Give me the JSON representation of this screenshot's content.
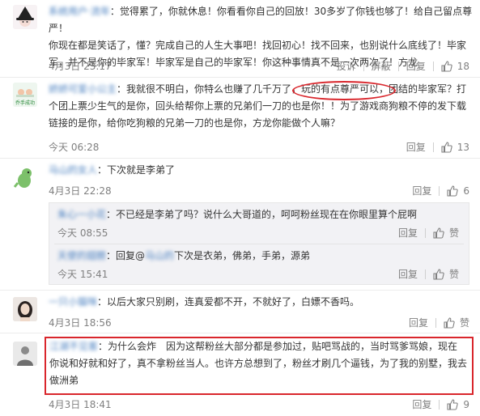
{
  "comments": [
    {
      "username": "系统用户·流年",
      "text_lines": [
        "觉得累了，你就休息！你看看你自己的回放！30多岁了你钱也够了！给自己留点尊严！",
        "你现在都是笑话了，懂？完成自己的人生大事吧！找回初心！找不回来，也别说什么底线了！毕家",
        "军，并不是你的毕家军！毕家军是自己的毕家军！你这种事情真不是一次两次了！方龙"
      ],
      "time": "4月3日 23:17",
      "actions": [
        "投诉",
        "屏蔽",
        "回复"
      ],
      "likes": "18"
    },
    {
      "username": "娇娇可爱小公主",
      "avatar_text": "乔手成功",
      "text_lines": [
        "我就很不明白，你特么也赚了几千万了，玩的有点尊严可以，团结的毕家军？打",
        "个团上票少生气的是你，回头给帮你上票的兄弟们一刀的也是你！！为了游戏商狗粮不停的发下载",
        "链接的是你，给你吃狗粮的兄弟一刀的也是你，方龙你能做个人嘛？"
      ],
      "time": "今天 06:28",
      "actions": [
        "回复"
      ],
      "likes": "13"
    },
    {
      "username": "马山的女人",
      "text": "下次就是李弟了",
      "time": "4月3日 22:28",
      "actions": [
        "回复"
      ],
      "likes": "6",
      "replies": [
        {
          "username": "朱心一小花",
          "text": "：不已经是李弟了吗？说什么大哥道的，呵呵粉丝现在在你眼里算个屁啊",
          "time": "今天 08:55",
          "actions": [
            "回复"
          ],
          "likes": "赞"
        },
        {
          "username": "天使的翅膀",
          "reply_label": "：回复@",
          "mention": "马山的",
          "text": "下次是衣弟，佛弟，手弟，源弟",
          "time": "今天 15:41",
          "actions": [
            "回复"
          ],
          "likes": "赞"
        }
      ]
    },
    {
      "username": "一只小猫咪",
      "text": "：以后大家只别刷，连真爱都不开，不就好了，白嫖不香吗。",
      "time": "4月3日 18:56",
      "actions": [
        "回复"
      ],
      "likes": "赞"
    },
    {
      "username": "江湖不见客",
      "text_lines": [
        "：为什么会炸　因为这帮粉丝大部分都是参加过，贴吧骂战的，当时骂爹骂娘，现在",
        "你说和好就和好了，真不拿粉丝当人。也许方总想到了，粉丝才刷几个逼钱，为了我的别墅，我去",
        "做洲弟"
      ],
      "time": "4月3日 18:41",
      "actions": [
        "回复"
      ],
      "likes": "9"
    }
  ],
  "colors": {
    "link": "#4a80c0",
    "highlight": "#d9262c",
    "meta": "#808080"
  },
  "icons": [
    "thumbs-up-icon"
  ]
}
